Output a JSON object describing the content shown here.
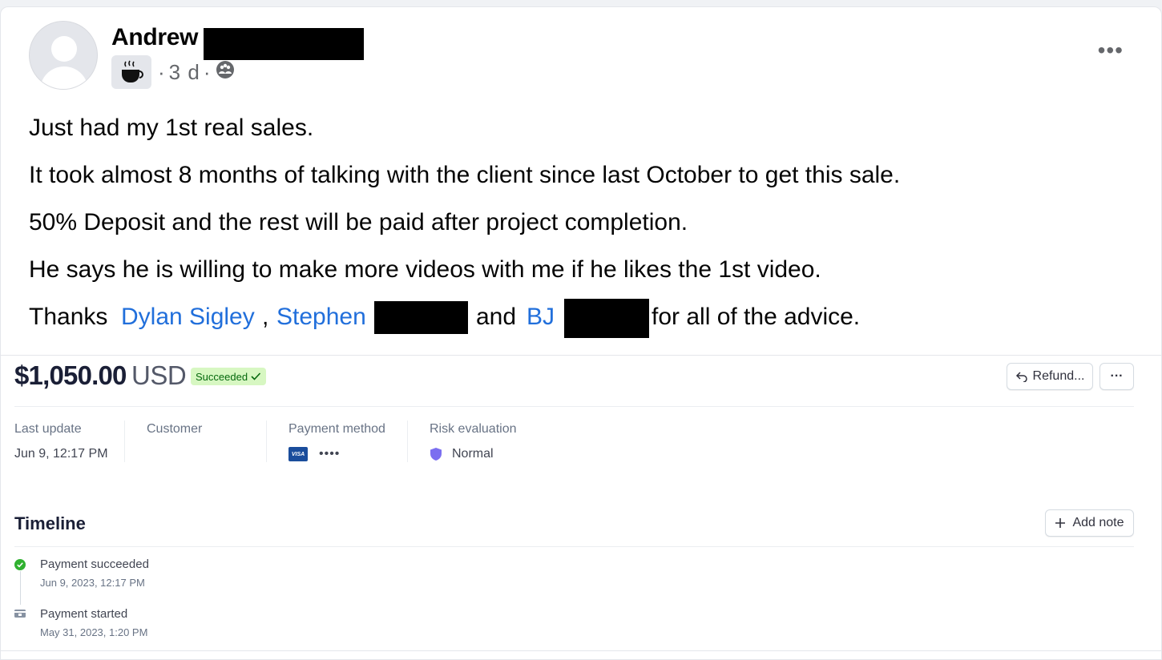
{
  "post": {
    "author": "Andrew",
    "time": "3 d",
    "separator": "·",
    "more": "•••",
    "paragraphs": [
      "Just had my 1st real sales.",
      "It took almost 8 months of talking with the client since last October to get this sale.",
      "50% Deposit and the rest will be paid after project completion.",
      "He says he is willing to make more videos with me if he likes the 1st video."
    ],
    "thanks": {
      "prefix": "Thanks ",
      "mention1": "Dylan Sigley",
      "comma": ", ",
      "mention2": "Stephen",
      "and": "and ",
      "mention3": "BJ",
      "suffix": "for all of the advice."
    }
  },
  "payment": {
    "amount": "$1,050.00",
    "currency": "USD",
    "status": "Succeeded",
    "refund_label": "Refund...",
    "more_label": "···",
    "details": {
      "last_update_label": "Last update",
      "last_update_value": "Jun 9, 12:17 PM",
      "customer_label": "Customer",
      "payment_method_label": "Payment method",
      "card_brand": "VISA",
      "card_masked": "••••",
      "risk_label": "Risk evaluation",
      "risk_value": "Normal"
    },
    "timeline": {
      "title": "Timeline",
      "add_note_label": "Add note",
      "events": [
        {
          "title": "Payment succeeded",
          "date": "Jun 9, 2023, 12:17 PM"
        },
        {
          "title": "Payment started",
          "date": "May 31, 2023, 1:20 PM"
        }
      ]
    }
  },
  "colors": {
    "link": "#216fdb",
    "success_badge_bg": "#d7f7c2",
    "success_badge_text": "#05690d",
    "visa_blue": "#1a4d9c",
    "shield_purple": "#7b6ff0",
    "check_green": "#30b130"
  }
}
